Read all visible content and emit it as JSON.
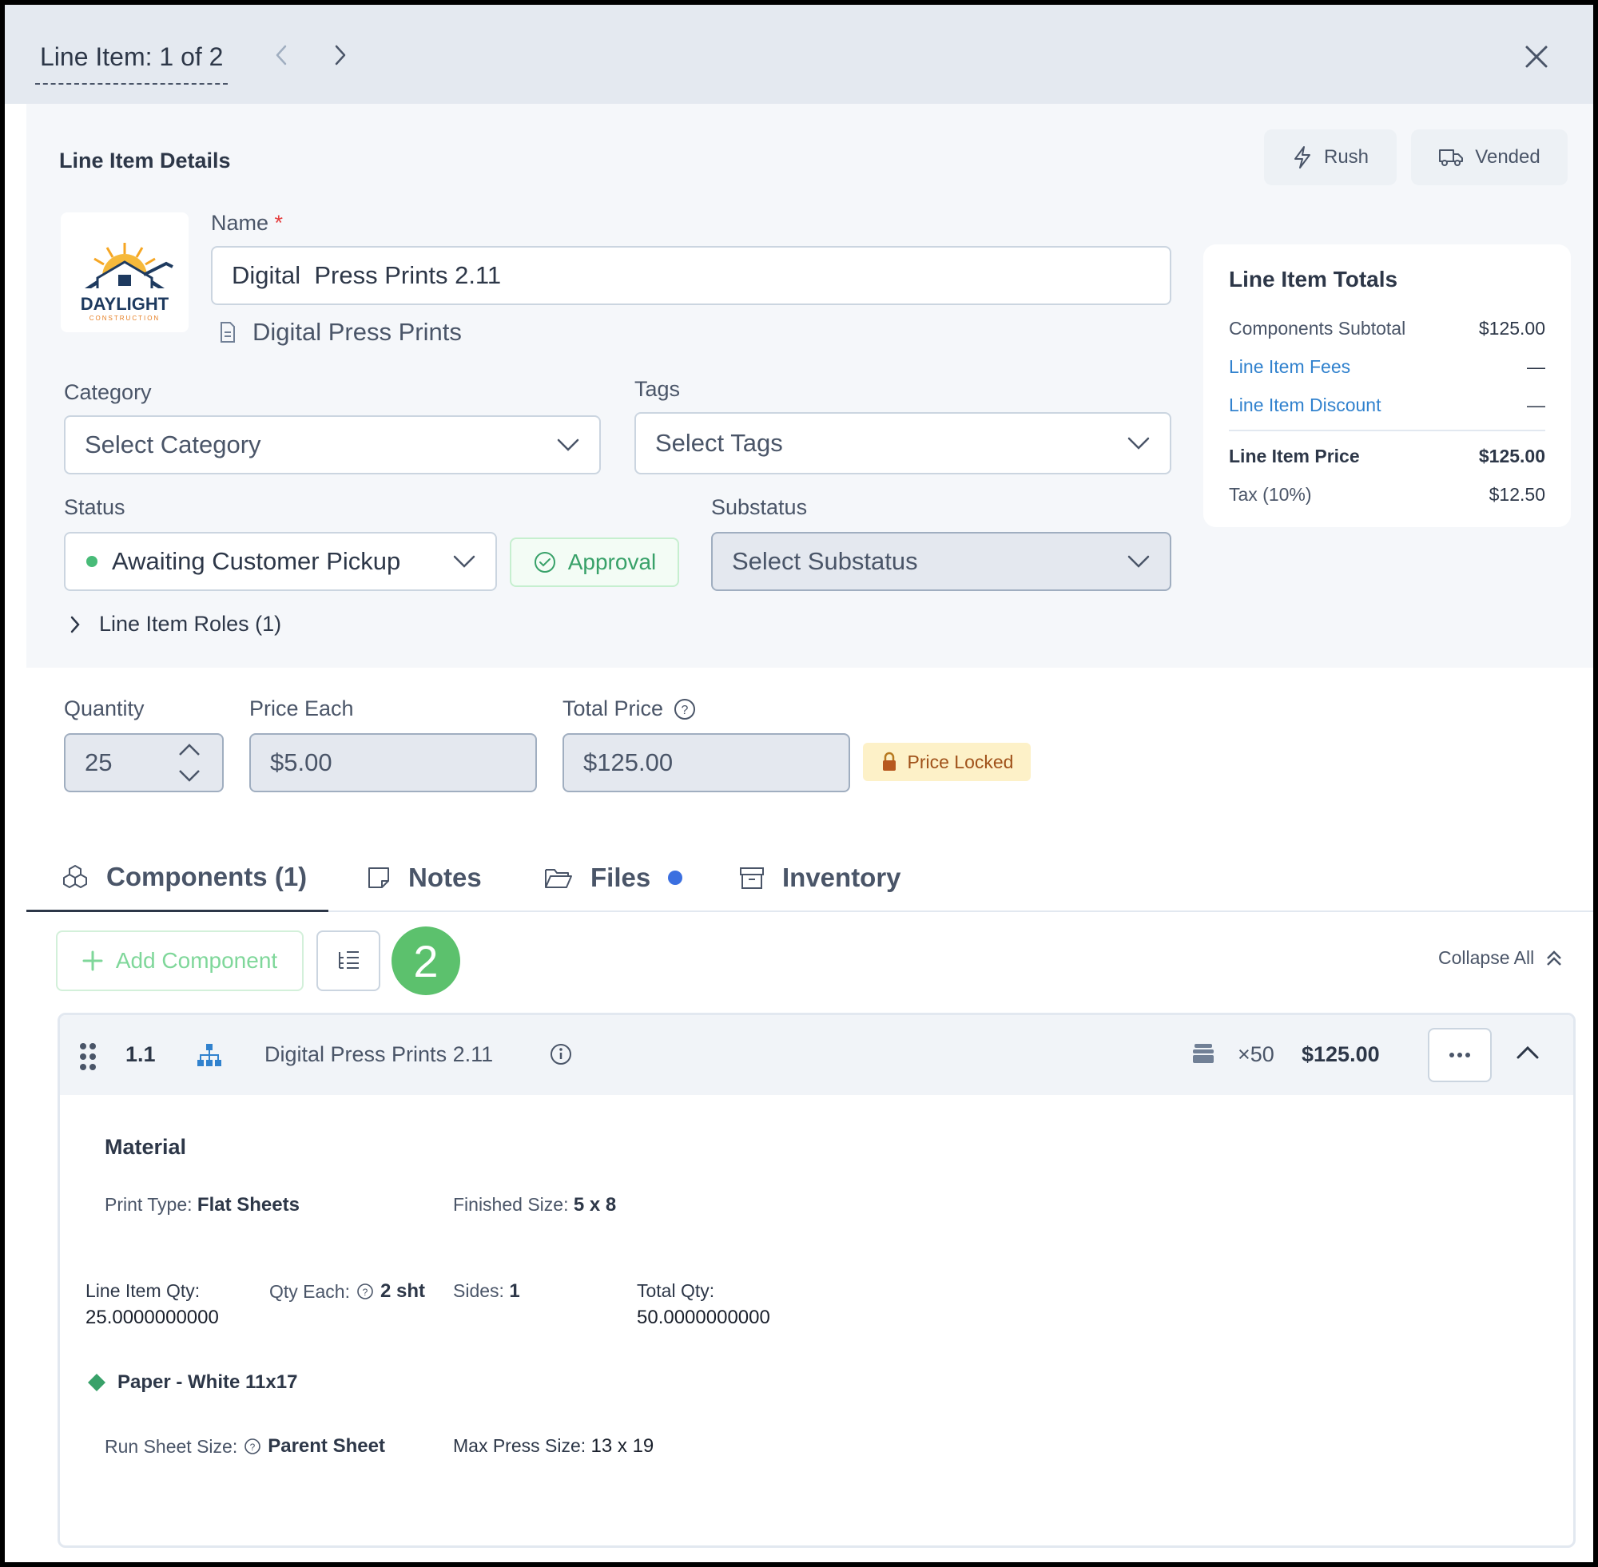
{
  "header": {
    "title": "Line Item: 1 of 2"
  },
  "details": {
    "section_title": "Line Item Details",
    "rush_label": "Rush",
    "vended_label": "Vended",
    "logo": {
      "brand": "DAYLIGHT",
      "sub": "CONSTRUCTION"
    },
    "name_label": "Name",
    "required_mark": "*",
    "name_value": "Digital  Press Prints 2.11",
    "product_link": "Digital Press Prints",
    "category_label": "Category",
    "category_placeholder": "Select Category",
    "tags_label": "Tags",
    "tags_placeholder": "Select Tags",
    "status_label": "Status",
    "status_value": "Awaiting Customer Pickup",
    "status_color": "#48bb78",
    "approval_label": "Approval",
    "substatus_label": "Substatus",
    "substatus_placeholder": "Select Substatus",
    "roles_label": "Line Item Roles (1)"
  },
  "totals": {
    "title": "Line Item Totals",
    "rows": [
      {
        "label": "Components Subtotal",
        "value": "$125.00"
      },
      {
        "label": "Line Item Fees",
        "value": "—"
      },
      {
        "label": "Line Item Discount",
        "value": "—"
      },
      {
        "label": "Line Item Price",
        "value": "$125.00"
      },
      {
        "label": "Tax (10%)",
        "value": "$12.50"
      }
    ]
  },
  "pricing": {
    "quantity_label": "Quantity",
    "quantity_value": "25",
    "price_each_label": "Price Each",
    "price_each_value": "$5.00",
    "total_price_label": "Total Price",
    "total_price_value": "$125.00",
    "price_locked_label": "Price Locked"
  },
  "tabs": [
    {
      "label": "Components (1)",
      "icon": "cubes-icon"
    },
    {
      "label": "Notes",
      "icon": "note-icon"
    },
    {
      "label": "Files",
      "icon": "folder-icon"
    },
    {
      "label": "Inventory",
      "icon": "archive-icon"
    }
  ],
  "toolbar": {
    "add_component": "Add Component",
    "badge_count": "2",
    "collapse_all": "Collapse All"
  },
  "component": {
    "number": "1.1",
    "name": "Digital Press Prints 2.11",
    "multiplier": "×50",
    "price": "$125.00",
    "section": "Material",
    "print_type_label": "Print Type:",
    "print_type_value": "Flat Sheets",
    "finished_size_label": "Finished Size:",
    "finished_size_value": "5 x 8",
    "line_item_qty_label": "Line Item Qty:",
    "line_item_qty_value": "25.0000000000",
    "qty_each_label": "Qty Each:",
    "qty_each_value": "2 sht",
    "sides_label": "Sides:",
    "sides_value": "1",
    "total_qty_label": "Total Qty:",
    "total_qty_value": "50.0000000000",
    "paper_label": "Paper - White 11x17",
    "paper_color": "#38a169",
    "run_sheet_label": "Run Sheet Size:",
    "run_sheet_value": "Parent Sheet",
    "max_press_label": "Max Press Size:",
    "max_press_value": "13 x 19"
  }
}
